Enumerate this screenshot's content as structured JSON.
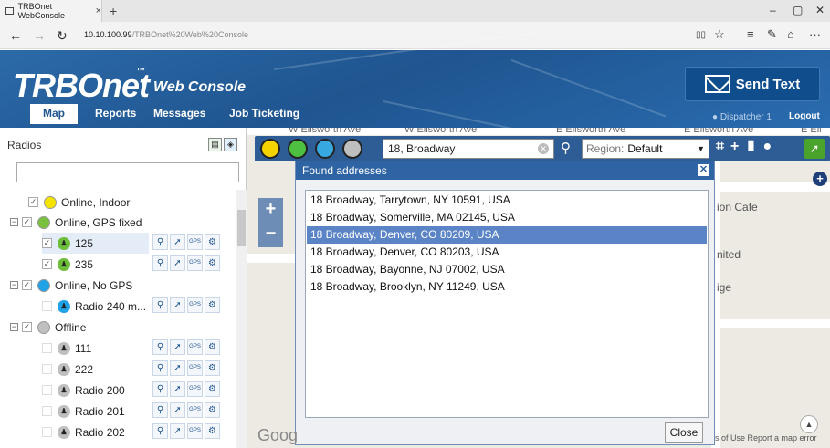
{
  "browser": {
    "tab_title": "TRBOnet WebConsole",
    "tab_close": "×",
    "new_tab": "+",
    "url_host": "10.10.100.99",
    "url_path": "/TRBOnet%20Web%20Console",
    "back": "←",
    "forward": "→",
    "refresh": "↻",
    "minimize": "–",
    "maximize": "▢",
    "close": "✕",
    "reading_view": "▯▯",
    "favorite": "☆",
    "hub": "≡",
    "notes": "✎",
    "share": "⌂",
    "more": "···"
  },
  "header": {
    "logo_main": "TRBOnet",
    "logo_tm": "™",
    "logo_sub": "Web Console",
    "send_text_label": "Send Text",
    "nav": [
      "Map",
      "Reports",
      "Messages",
      "Job Ticketing"
    ],
    "dispatcher": "Dispatcher 1",
    "logout": "Logout"
  },
  "left_panel": {
    "title": "Radios",
    "tree": [
      {
        "label": "Online, Indoor",
        "type": "group",
        "color": "#f5e400"
      },
      {
        "label": "Online, GPS fixed",
        "type": "group",
        "color": "#79c13f",
        "expander": "−"
      },
      {
        "label": "125",
        "type": "radio",
        "color": "#6dbe3a",
        "selected": true
      },
      {
        "label": "235",
        "type": "radio",
        "color": "#6dbe3a"
      },
      {
        "label": "Online, No GPS",
        "type": "group",
        "color": "#1fa2e6",
        "expander": "−"
      },
      {
        "label": "Radio 240 m...",
        "type": "radio",
        "color": "#1fa2e6"
      },
      {
        "label": "Offline",
        "type": "group",
        "color": "#c0c0c0",
        "expander": "−"
      },
      {
        "label": "111",
        "type": "radio",
        "color": "#bfbfbf"
      },
      {
        "label": "222",
        "type": "radio",
        "color": "#bfbfbf"
      },
      {
        "label": "Radio 200",
        "type": "radio",
        "color": "#bfbfbf"
      },
      {
        "label": "Radio 201",
        "type": "radio",
        "color": "#bfbfbf"
      },
      {
        "label": "Radio 202",
        "type": "radio",
        "color": "#bfbfbf"
      }
    ],
    "action_icons": [
      "search-icon",
      "locate-icon",
      "gps-icon",
      "gear-icon"
    ],
    "gps_label": "GPS"
  },
  "toolbar": {
    "search_value": "18, Broadway",
    "region_label": "Region:",
    "region_value": "Default",
    "vehicle_colors": [
      "#f5d300",
      "#4ec041",
      "#38a8e0",
      "#bfbfbf"
    ]
  },
  "dialog": {
    "title": "Found addresses",
    "items": [
      "18 Broadway, Tarrytown, NY 10591, USA",
      "18 Broadway, Somerville, MA 02145, USA",
      "18 Broadway, Denver, CO 80209, USA",
      "18 Broadway, Denver, CO 80203, USA",
      "18 Broadway, Bayonne, NJ 07002, USA",
      "18 Broadway, Brooklyn, NY 11249, USA"
    ],
    "selected_index": 2,
    "close_label": "Close"
  },
  "map": {
    "labels": [
      "ion Cafe",
      "nited",
      "ige"
    ],
    "street_labels": [
      "W Ellsworth Ave",
      "W Ellsworth Ave",
      "E Ellsworth Ave",
      "E Ellsworth Ave",
      "E Ell"
    ],
    "google": "Goog",
    "footer": "s of Use   Report a map error"
  }
}
